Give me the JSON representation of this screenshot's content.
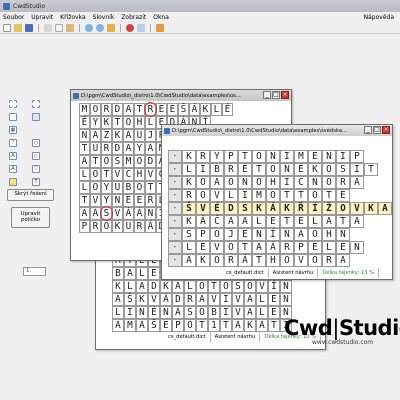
{
  "window_title": "CwdStudio",
  "menu": [
    "Soubor",
    "Upravit",
    "Křížovka",
    "Slovník",
    "Zobrazit",
    "Okna"
  ],
  "menu_help": "Nápověda",
  "left_panel": {
    "hide_solution": "Skrýt řešení",
    "edit_field": "Upravit políčko",
    "spin_value": "1"
  },
  "win1": {
    "title": "D:\\pgm\\CwdStudio\\_distro\\1.0\\CwdStudio\\data\\examples\\os...",
    "rows": [
      "MORDATREEŠÁKLÉ",
      "ĚYKTOHLEDÁNÍ",
      "NAZKAUJPPUNÍCH",
      "TURDAYANOVOK",
      "ATOSMODAMOZÁRN",
      "LOTVCHVCISNYL",
      "LOYUBOTTOUVÍRA",
      "TVYNEEŘLNEVH",
      "AASVÁÁNITÁTVI",
      "PROKURÁDOR"
    ]
  },
  "win2": {
    "title": "D:\\pgm\\CwdStudio\\_distro\\1.0\\CwdStudio\\data\\examples\\švédska...",
    "rows": [
      "KRYPTONIMENIP",
      "LIBRETONEKOSIT",
      "KOAONOHICNORA",
      "ROVLIMOTTOTE",
      "ŠVÉDSKÁKŘÍŽOVKA",
      "KÁČAALETELATA",
      "SPOJENÍNAOHN",
      "LEVOTAÁRPELEN",
      "AKORÁTHOVORA"
    ],
    "status": [
      "cs_default.dict",
      "Asistent návrhu",
      "Délka tajenky: 13 %"
    ]
  },
  "win3": {
    "rows": [
      "ATĚEPNAČEKAV",
      "BALENECINA",
      "KLADKALOTOSOVÍN",
      "AŠKVÁDRAVIVALEN",
      "LINÉNÁSOBIVALEN",
      "AMAŠEPOT1TAKATI"
    ],
    "status": [
      "cs_default.dict",
      "Asistent návrhu",
      "Délka tajenky: 10 %"
    ]
  },
  "logo": {
    "left": "Cwd",
    "right": "Studio",
    "url": "www.cwdstudio.com"
  },
  "colors": {
    "highlight": "#fff4c0",
    "circle": "#d33333"
  }
}
